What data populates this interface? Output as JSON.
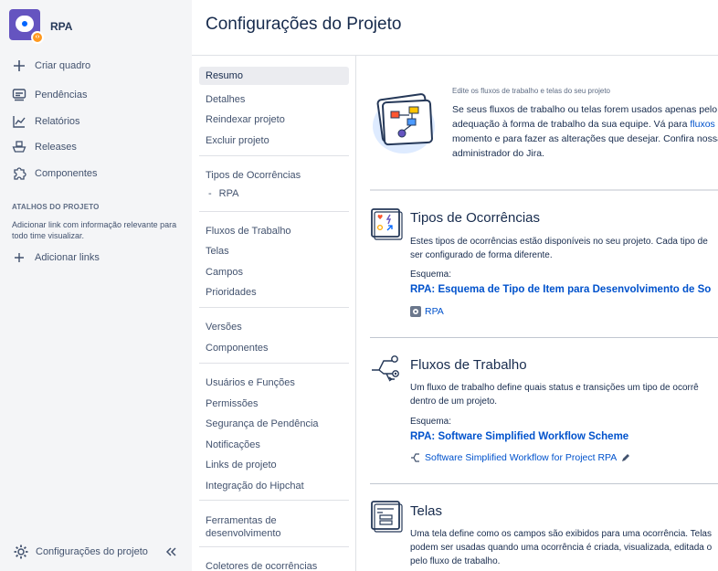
{
  "project": {
    "name": "RPA"
  },
  "sidebar": {
    "items": [
      {
        "label": "Criar quadro",
        "icon": "plus-icon"
      },
      {
        "label": "Pendências",
        "icon": "backlog-icon"
      },
      {
        "label": "Relatórios",
        "icon": "reports-icon"
      },
      {
        "label": "Releases",
        "icon": "ship-icon"
      },
      {
        "label": "Componentes",
        "icon": "puzzle-icon"
      }
    ],
    "shortcuts_title": "ATALHOS DO PROJETO",
    "shortcuts_desc": "Adicionar link com informação relevante para todo time visualizar.",
    "add_links": "Adicionar links",
    "settings": "Configurações do projeto"
  },
  "header": {
    "title": "Configurações do Projeto"
  },
  "subnav": {
    "resumo": "Resumo",
    "detalhes": "Detalhes",
    "reindexar": "Reindexar projeto",
    "excluir": "Excluir projeto",
    "tipos": "Tipos de Ocorrências",
    "tipos_sub": "RPA",
    "fluxos": "Fluxos de Trabalho",
    "telas": "Telas",
    "campos": "Campos",
    "prioridades": "Prioridades",
    "versoes": "Versões",
    "componentes": "Componentes",
    "usuarios": "Usuários e Funções",
    "permissoes": "Permissões",
    "seguranca": "Segurança de Pendência",
    "notificacoes": "Notificações",
    "links": "Links de projeto",
    "hipchat": "Integração do Hipchat",
    "ferramentas": "Ferramentas de desenvolvimento",
    "coletores": "Coletores de ocorrências"
  },
  "intro": {
    "title": "Edite os fluxos de trabalho e telas do seu projeto",
    "text_1": "Se seus fluxos de trabalho ou telas forem usados apenas pelo s",
    "text_2a": "adequação à forma de trabalho da sua equipe. Vá para ",
    "text_2b": "fluxos d",
    "text_3": "momento e para fazer as alterações que desejar. Confira nossa",
    "text_4": "administrador do Jira."
  },
  "issue_types": {
    "title": "Tipos de Ocorrências",
    "desc_1": "Estes tipos de ocorrências estão disponíveis no seu projeto. Cada tipo de",
    "desc_2": "ser configurado de forma diferente.",
    "scheme_label": "Esquema:",
    "scheme": "RPA: Esquema de Tipo de Item para Desenvolvimento de So",
    "link": "RPA"
  },
  "workflows": {
    "title": "Fluxos de Trabalho",
    "desc_1": "Um fluxo de trabalho define quais status e transições um tipo de ocorrê",
    "desc_2": "dentro de um projeto.",
    "scheme_label": "Esquema:",
    "scheme": "RPA: Software Simplified Workflow Scheme",
    "link": "Software Simplified Workflow for Project RPA"
  },
  "screens": {
    "title": "Telas",
    "desc_1": "Uma tela define como os campos são exibidos para uma ocorrência. Telas",
    "desc_2": "podem ser usadas quando uma ocorrência é criada, visualizada, editada o",
    "desc_3": "pelo fluxo de trabalho."
  },
  "colors": {
    "link": "#0052cc",
    "sidebar_bg": "#f4f5f7",
    "text": "#172b4d",
    "avatar": "#6554c0",
    "badge": "#ff991f"
  }
}
